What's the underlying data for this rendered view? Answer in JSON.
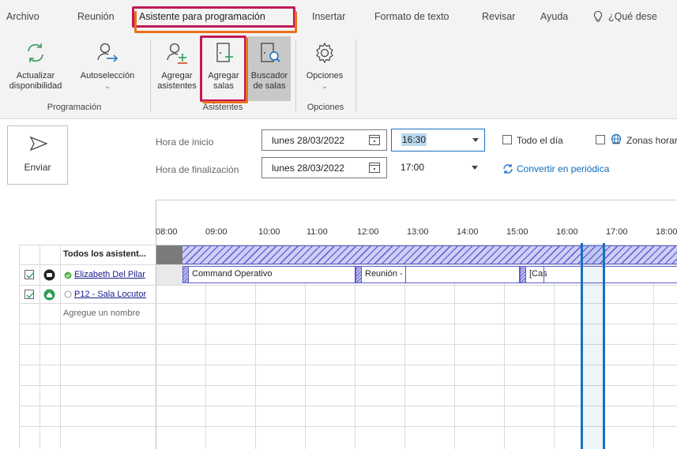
{
  "menu": {
    "tabs": [
      "Archivo",
      "Reunión",
      "Asistente para programación",
      "Insertar",
      "Formato de texto",
      "Revisar",
      "Ayuda"
    ],
    "active_tab": "Asistente para programación",
    "tell_me": "¿Qué dese"
  },
  "ribbon": {
    "refresh_label_1": "Actualizar",
    "refresh_label_2": "disponibilidad",
    "autoselect_label": "Autoselección",
    "add_attendees_1": "Agregar",
    "add_attendees_2": "asistentes",
    "add_rooms_1": "Agregar",
    "add_rooms_2": "salas",
    "room_finder_1": "Buscador",
    "room_finder_2": "de salas",
    "options_label": "Opciones",
    "group_programacion": "Programación",
    "group_asistentes": "Asistentes",
    "group_opciones": "Opciones"
  },
  "form": {
    "send_label": "Enviar",
    "start_label": "Hora de inicio",
    "end_label": "Hora de finalización",
    "start_date": "lunes 28/03/2022",
    "end_date": "lunes 28/03/2022",
    "start_time": "16:30",
    "end_time": "17:00",
    "all_day_label": "Todo el día",
    "time_zones_label": "Zonas horar",
    "recurring_label": "Convertir en periódica"
  },
  "grid": {
    "hours": [
      "08:00",
      "09:00",
      "10:00",
      "11:00",
      "12:00",
      "13:00",
      "14:00",
      "15:00",
      "16:00",
      "17:00",
      "18:00"
    ],
    "all_attendees_label": "Todos los asistent...",
    "attendees": [
      {
        "name": "Elizabeth Del Pilar",
        "checked": true,
        "status": "organizer"
      },
      {
        "name": "P12 - Sala Locutor",
        "checked": true,
        "status": "room"
      }
    ],
    "add_name_placeholder": "Agregue un nombre",
    "busy_blocks": [
      {
        "label": "Command Operativo",
        "start": "09:00",
        "end": "12:00"
      },
      {
        "label": "Reunión -",
        "start": "12:00",
        "end": "14:00"
      },
      {
        "label": "[Cas",
        "start": "15:15",
        "end": "17:00"
      }
    ],
    "selected_slot": {
      "start": "16:30",
      "end": "17:00"
    }
  },
  "colors": {
    "tab_highlight": "#c2185b",
    "ribbon_highlight": "#e8711c",
    "selection_border": "#1a6fc0",
    "busy_border": "#5b5bc8",
    "link": "#0f6cbd"
  }
}
